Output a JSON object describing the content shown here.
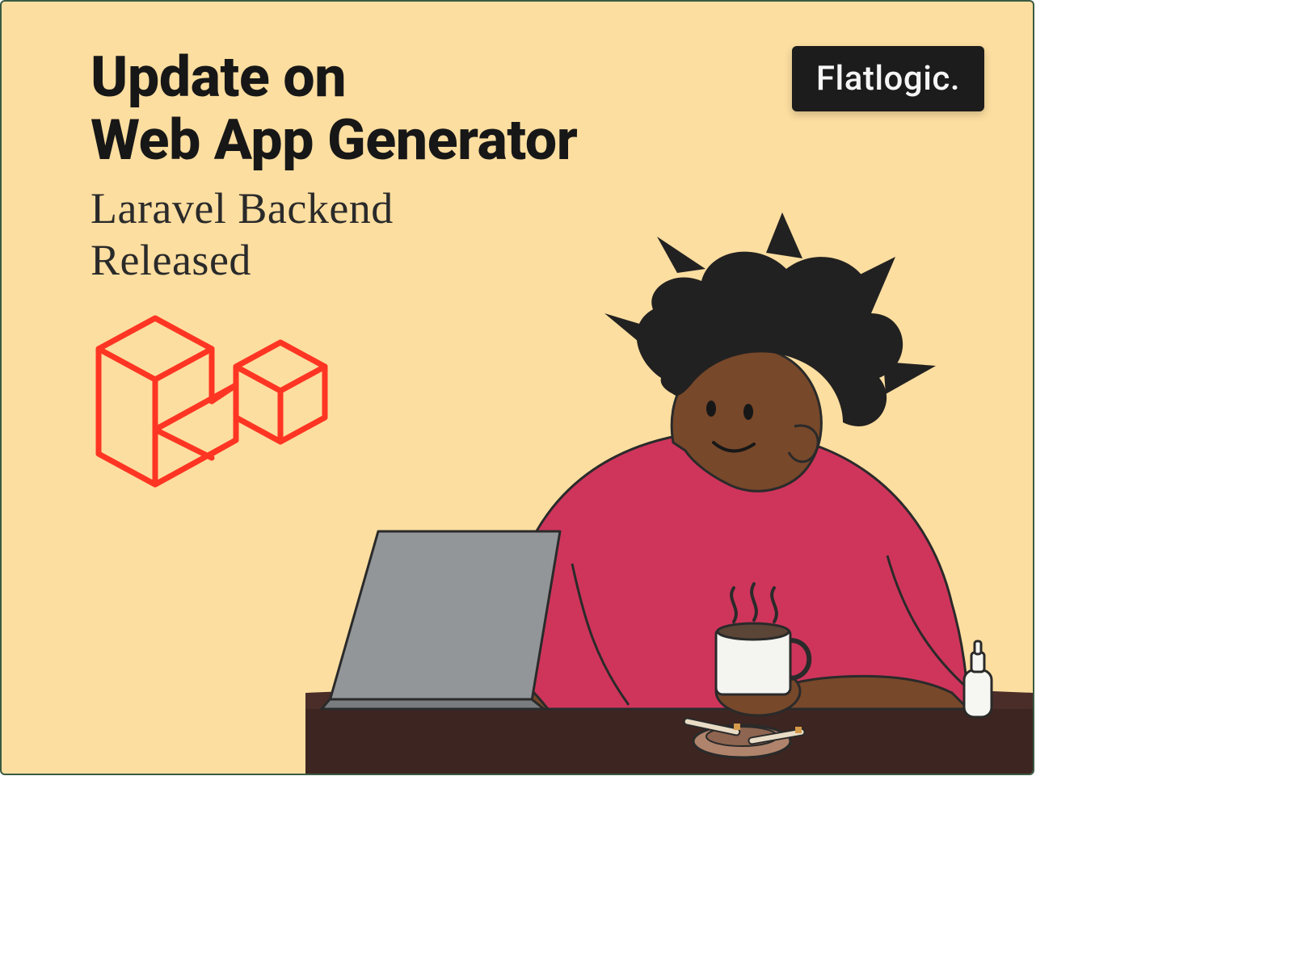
{
  "heading_line1": "Update on",
  "heading_line2": "Web App Generator",
  "subheading_line1": "Laravel Backend",
  "subheading_line2": "Released",
  "brand": "Flatlogic.",
  "colors": {
    "card_bg": "#fcdea0",
    "card_border": "#3a5a42",
    "heading": "#171717",
    "subheading": "#2a2a2a",
    "brand_bg": "#1c1c1c",
    "brand_fg": "#f6f6f6",
    "laravel": "#ff3523",
    "shirt": "#cf355b",
    "skin": "#77482a",
    "hair": "#222121",
    "desk": "#3d2521",
    "laptop": "#939699",
    "mug": "#f4f4f0",
    "coffee": "#5a4536"
  },
  "icons": {
    "laravel": "laravel-logo-icon",
    "person": "person-illustration-icon",
    "laptop": "laptop-icon",
    "mug": "coffee-mug-icon",
    "ashtray": "ashtray-icon",
    "bottle": "spray-bottle-icon"
  }
}
